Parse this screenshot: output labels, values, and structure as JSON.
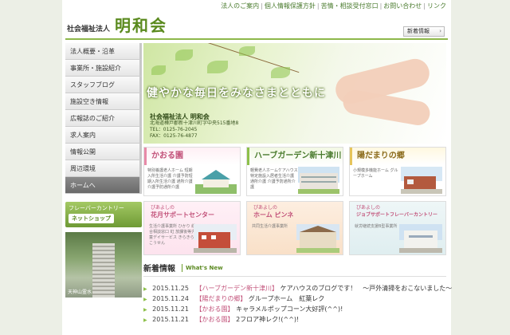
{
  "header": {
    "top_links": [
      "法人のご案内",
      "個人情報保護方針",
      "苦情・相談受付窓口",
      "お問い合わせ",
      "リンク"
    ],
    "corp_label": "社会福祉法人",
    "org_name": "明和会",
    "news_button": "新着情報"
  },
  "sidebar": {
    "items": [
      {
        "label": "法人概要・沿革"
      },
      {
        "label": "事業所・施設紹介"
      },
      {
        "label": "スタッフブログ"
      },
      {
        "label": "施設空き情報"
      },
      {
        "label": "広報誌のご紹介"
      },
      {
        "label": "求人案内"
      },
      {
        "label": "情報公開"
      },
      {
        "label": "周辺環境"
      },
      {
        "label": "ホームへ"
      }
    ],
    "banner_line1": "フレーバーカントリー",
    "banner_line2": "ネットショップ",
    "photo_caption": "天神山霊水"
  },
  "hero": {
    "tagline": "健やかな毎日をみなさまとともに",
    "org_title": "社会福祉法人 明和会",
    "address": "北海道樺戸郡新十津川町字中央515番地8",
    "tel": "TEL：0125-76-2045",
    "fax": "FAX：0125-76-4877"
  },
  "facilities": [
    {
      "name": "かおる園",
      "desc": "特別養護老人ホーム 短期入所生活介護 介護予防短期入所生活介護 通所介護 介護予防通所介護"
    },
    {
      "name": "ハーブガーデン新十津川",
      "desc": "軽費老人ホームケアハウス 特定施設入居者生活介護 通所介護 介護予防通所介護"
    },
    {
      "name": "陽だまりの郷",
      "desc": "小規模多機能ホーム グループホーム"
    }
  ],
  "facilities2": [
    {
      "sub": "ぴあよしの",
      "name": "花月サポートセンター",
      "desc": "生活介護事業所 ひかり 総合相談窓口 虹 放課後等児童デイサービス きらきらひこうせん"
    },
    {
      "sub": "ぴあよしの",
      "name": "ホーム ピンネ",
      "desc": "共同生活介護事業所"
    },
    {
      "sub": "ぴあよしの",
      "name": "ジョブサポートフレーバーカントリー",
      "desc": "就労継続支援B型事業所"
    }
  ],
  "news": {
    "title": "新着情報",
    "title_en": "What's New",
    "items": [
      {
        "date": "2015.11.25",
        "cat": "【ハーブガーデン新十津川】",
        "text": "ケアハウスのブログです！　～戸外清掃をおこないました～"
      },
      {
        "date": "2015.11.24",
        "cat": "【陽だまりの郷】",
        "text": "グループホーム　紅葉レク"
      },
      {
        "date": "2015.11.21",
        "cat": "【かおる園】",
        "text": "キャラメルポップコーン大好評(^^)!"
      },
      {
        "date": "2015.11.21",
        "cat": "【かおる園】",
        "text": "2フロア神レク!(^^)!"
      }
    ]
  },
  "colors": {
    "accent": "#8dc04a",
    "brand": "#5a8a1e",
    "pink": "#c2527a"
  }
}
